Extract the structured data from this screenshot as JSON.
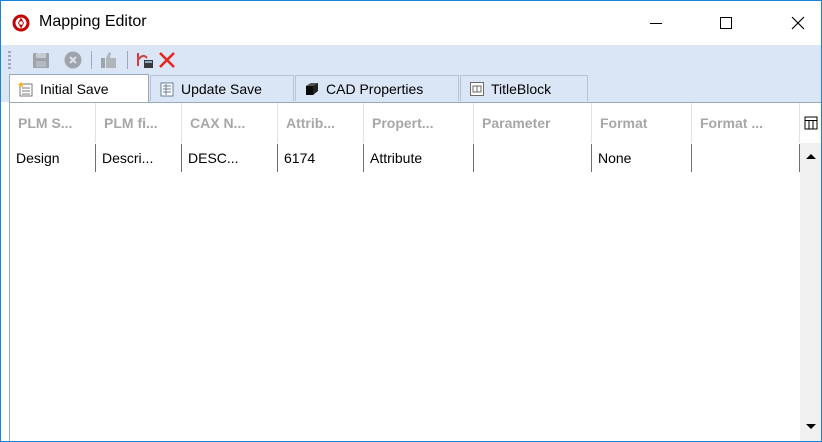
{
  "window": {
    "title": "Mapping Editor",
    "icons": {
      "app": "app-logo-icon",
      "minimize": "minimize-icon",
      "maximize": "maximize-icon",
      "close": "close-icon"
    }
  },
  "toolbar": {
    "icons": [
      "save-icon",
      "cancel-icon",
      "thumbs-up-icon",
      "mapping-edit-icon",
      "delete-icon"
    ]
  },
  "tabs": [
    {
      "label": "Initial Save",
      "icon": "sheet-star-icon",
      "active": true
    },
    {
      "label": "Update Save",
      "icon": "sheet-icon",
      "active": false
    },
    {
      "label": "CAD Properties",
      "icon": "cube-icon",
      "active": false
    },
    {
      "label": "TitleBlock",
      "icon": "titleblock-icon",
      "active": false
    }
  ],
  "grid": {
    "columns": [
      "PLM S...",
      "PLM fi...",
      "CAX N...",
      "Attrib...",
      "Propert...",
      "Parameter",
      "Format",
      "Format ..."
    ],
    "rows": [
      [
        "Design",
        "Descri...",
        "DESC...",
        "6174",
        "Attribute",
        "",
        "None",
        ""
      ]
    ]
  },
  "colors": {
    "accent": "#1883d7",
    "toolbar_bg": "#dae6f6",
    "header_text": "#a7a7a7",
    "delete_red": "#e0291f"
  }
}
